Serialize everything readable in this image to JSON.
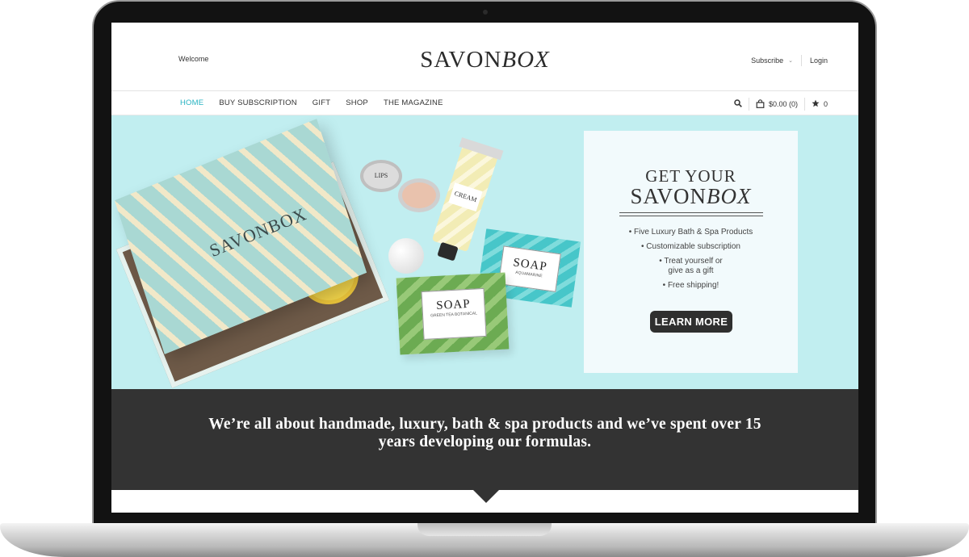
{
  "header": {
    "welcome": "Welcome",
    "logo_main": "SAVON",
    "logo_italic": "BOX",
    "subscribe": "Subscribe",
    "login": "Login"
  },
  "nav": {
    "items": [
      "HOME",
      "BUY SUBSCRIPTION",
      "GIFT",
      "SHOP",
      "THE MAGAZINE"
    ],
    "cart": "$0.00 (0)",
    "wishlist_count": "0"
  },
  "hero": {
    "product_labels": {
      "box": "SAVONBOX",
      "lips": "LIPS",
      "cream": "CREAM",
      "soap_back": "SOAP",
      "soap_back_sub": "AQUAMARINE",
      "soap_front": "SOAP",
      "soap_front_sub": "GREEN TEA BOTANICAL"
    },
    "card": {
      "title_line1": "GET YOUR",
      "title_main": "SAVON",
      "title_italic": "BOX",
      "bullets": [
        "• Five Luxury Bath & Spa Products",
        "• Customizable subscription",
        "• Treat yourself or",
        "give as a gift",
        "• Free shipping!"
      ],
      "cta": "LEARN MORE"
    }
  },
  "tagline": {
    "text": "We’re all about handmade, luxury, bath & spa products and we’ve spent over 15 years developing our formulas."
  },
  "colors": {
    "accent": "#27b3c2",
    "hero_bg": "#c1eef0",
    "band_bg": "#333333",
    "button_bg": "#2f2f2f"
  },
  "icons": [
    "search-icon",
    "bag-icon",
    "star-icon",
    "chevron-down-icon"
  ]
}
